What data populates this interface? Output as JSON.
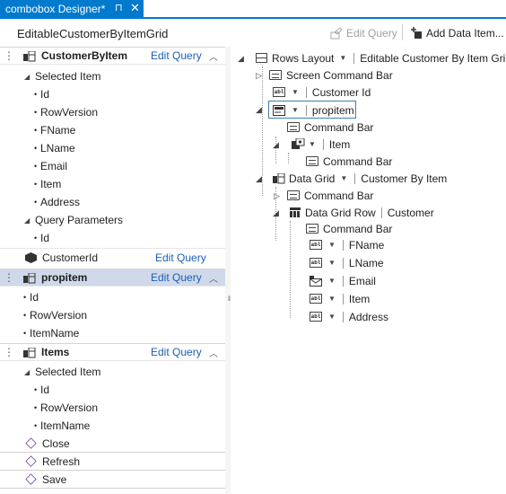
{
  "tab": {
    "title": "combobox Designer*",
    "pin_glyph": "⊓",
    "close_glyph": "✕"
  },
  "header": {
    "screen_name": "EditableCustomerByItemGrid",
    "edit_query_label": "Edit Query",
    "add_data_item_label": "Add Data Item..."
  },
  "left": {
    "customer_query": {
      "title": "CustomerByItem",
      "edit_label": "Edit Query",
      "selected_item_label": "Selected Item",
      "fields": [
        "Id",
        "RowVersion",
        "FName",
        "LName",
        "Email",
        "Item",
        "Address"
      ],
      "params_label": "Query Parameters",
      "params": [
        "Id"
      ]
    },
    "customer_id": {
      "label": "CustomerId",
      "edit_label": "Edit Query"
    },
    "propitem": {
      "title": "propitem",
      "edit_label": "Edit Query",
      "fields": [
        "Id",
        "RowVersion",
        "ItemName"
      ]
    },
    "items": {
      "title": "Items",
      "edit_label": "Edit Query",
      "selected_item_label": "Selected Item",
      "fields": [
        "Id",
        "RowVersion",
        "ItemName"
      ]
    },
    "methods": [
      "Close",
      "Refresh",
      "Save"
    ]
  },
  "tree": {
    "root": {
      "label": "Rows Layout",
      "value": "Editable Customer By Item Grid"
    },
    "screen_command_bar": "Screen Command Bar",
    "customer_id": "Customer Id",
    "propitem": "propitem",
    "command_bar": "Command Bar",
    "item": "Item",
    "item_command_bar": "Command Bar",
    "data_grid": {
      "label": "Data Grid",
      "value": "Customer By Item"
    },
    "grid_command_bar": "Command Bar",
    "data_grid_row": {
      "label": "Data Grid Row",
      "value": "Customer"
    },
    "row_command_bar": "Command Bar",
    "columns": [
      "FName",
      "LName",
      "Email",
      "Item",
      "Address"
    ]
  },
  "colors": {
    "accent": "#007acc",
    "link": "#1a5fb4",
    "selected_header": "#cfd9ea"
  }
}
